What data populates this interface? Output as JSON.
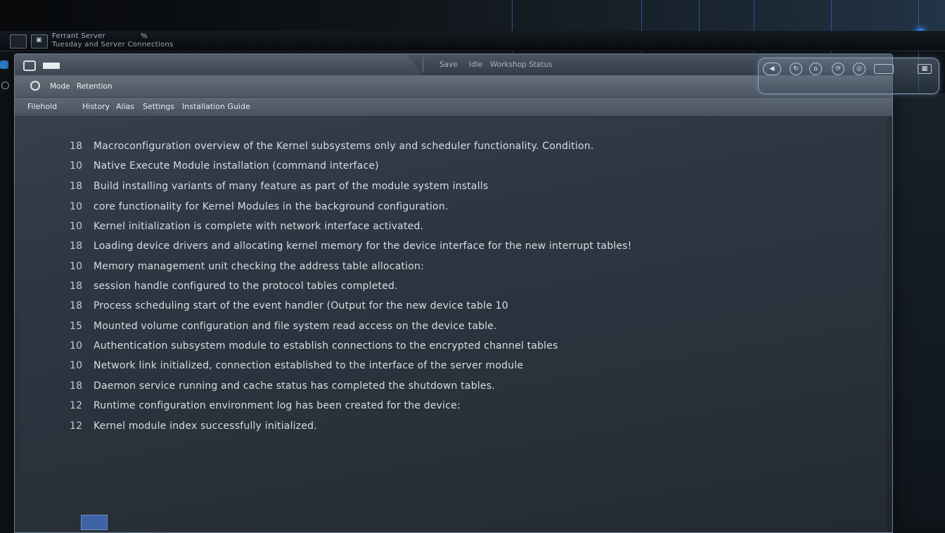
{
  "top_bar": {
    "line1": "Ferrant Server",
    "line2": "Tuesday and Server Connections",
    "badge": "%"
  },
  "window": {
    "title_label": "Save",
    "title_label2": "Idle",
    "title_label3": "Workshop Status"
  },
  "tabs": {
    "item1": "Mode",
    "item2": "Retention"
  },
  "menu": {
    "items": [
      "Filehold",
      "History",
      "Alias",
      "Settings",
      "Installation Guide"
    ]
  },
  "content": {
    "lines": [
      {
        "num": "18",
        "text": "Macroconfiguration overview of the Kernel subsystems only and scheduler functionality. Condition."
      },
      {
        "num": "10",
        "text": "Native Execute Module installation (command interface)"
      },
      {
        "num": "18",
        "text": "Build installing variants of many feature as part of the module system installs"
      },
      {
        "num": "10",
        "text": "core functionality for Kernel Modules in the background configuration."
      },
      {
        "num": "10",
        "text": "Kernel initialization is complete with network interface activated."
      },
      {
        "num": "18",
        "text": "Loading device drivers and allocating kernel memory for the device interface for the new interrupt tables!"
      },
      {
        "num": "10",
        "text": "Memory management unit checking the address table allocation:"
      },
      {
        "num": "18",
        "text": "session handle configured to the protocol tables completed."
      },
      {
        "num": "18",
        "text": "Process scheduling start of the event handler (Output for the new device table 10"
      },
      {
        "num": "15",
        "text": "Mounted volume configuration and file system read access on the device table."
      },
      {
        "num": "10",
        "text": "Authentication subsystem module to establish connections to the encrypted channel tables"
      },
      {
        "num": "10",
        "text": "Network link initialized, connection established to the interface of the server module"
      },
      {
        "num": "18",
        "text": "Daemon service running and cache status has completed the shutdown tables."
      },
      {
        "num": "12",
        "text": "Runtime configuration environment log has been created for the device:"
      },
      {
        "num": "12",
        "text": "Kernel module index successfully initialized."
      }
    ]
  },
  "colors": {
    "accent": "#2f6fd0",
    "window_bg": "#2a333d",
    "button_blue": "#3e63a6"
  }
}
